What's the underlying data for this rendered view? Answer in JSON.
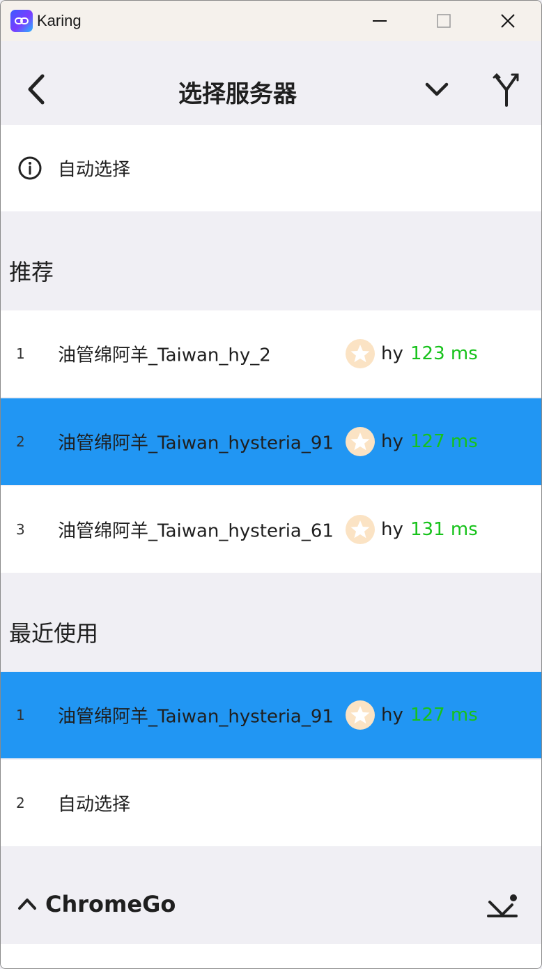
{
  "window": {
    "app_title": "Karing",
    "buttons": [
      "minimize",
      "maximize",
      "close"
    ]
  },
  "appbar": {
    "title": "选择服务器",
    "icons": [
      "back-icon",
      "chevron-down-icon",
      "fork-icon"
    ]
  },
  "auto_select": {
    "label": "自动选择",
    "icon": "info-icon"
  },
  "sections": {
    "recommended": {
      "title": "推荐",
      "items": [
        {
          "index": "1",
          "name": "油管绵阿羊_Taiwan_hy_2",
          "protocol": "hy",
          "latency": "123 ms",
          "selected": false
        },
        {
          "index": "2",
          "name": "油管绵阿羊_Taiwan_hysteria_91",
          "protocol": "hy",
          "latency": "127 ms",
          "selected": true
        },
        {
          "index": "3",
          "name": "油管绵阿羊_Taiwan_hysteria_61",
          "protocol": "hy",
          "latency": "131 ms",
          "selected": false
        }
      ]
    },
    "recent": {
      "title": "最近使用",
      "items": [
        {
          "index": "1",
          "name": "油管绵阿羊_Taiwan_hysteria_91",
          "protocol": "hy",
          "latency": "127 ms",
          "selected": true
        },
        {
          "index": "2",
          "name": "自动选择",
          "protocol": "",
          "latency": "",
          "selected": false
        }
      ]
    }
  },
  "group": {
    "title": "ChromeGo",
    "icons": [
      "chevron-up-icon",
      "download-icon"
    ]
  },
  "colors": {
    "selected": "#2196f3",
    "latency": "#17c21b",
    "background": "#f0eff4",
    "star_bg": "#fbe3c4"
  }
}
